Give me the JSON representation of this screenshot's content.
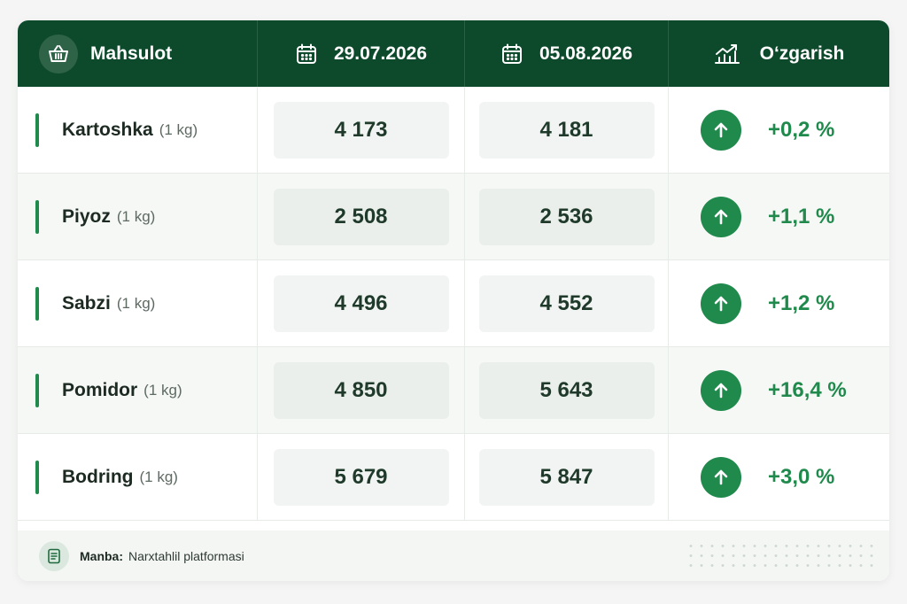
{
  "header": {
    "product": "Mahsulot",
    "date1": "29.07.2026",
    "date2": "05.08.2026",
    "change": "O‘zgarish"
  },
  "icons": {
    "product": "basket-icon",
    "date1": "calendar-icon",
    "date2": "calendar-icon",
    "change": "trend-chart-icon",
    "row_change": "arrow-up-icon",
    "source": "document-icon"
  },
  "colors": {
    "header_bg": "#0d4a2b",
    "accent_green": "#1f8a4c"
  },
  "rows": [
    {
      "name": "Kartoshka",
      "unit": "(1 kg)",
      "price1": "4 173",
      "price2": "4 181",
      "change": "+0,2 %"
    },
    {
      "name": "Piyoz",
      "unit": "(1 kg)",
      "price1": "2 508",
      "price2": "2 536",
      "change": "+1,1 %"
    },
    {
      "name": "Sabzi",
      "unit": "(1 kg)",
      "price1": "4 496",
      "price2": "4 552",
      "change": "+1,2 %"
    },
    {
      "name": "Pomidor",
      "unit": "(1 kg)",
      "price1": "4 850",
      "price2": "5 643",
      "change": "+16,4 %"
    },
    {
      "name": "Bodring",
      "unit": "(1 kg)",
      "price1": "5 679",
      "price2": "5 847",
      "change": "+3,0 %"
    }
  ],
  "footer": {
    "source_label": "Manba:",
    "source_value": "Narxtahlil platformasi"
  }
}
